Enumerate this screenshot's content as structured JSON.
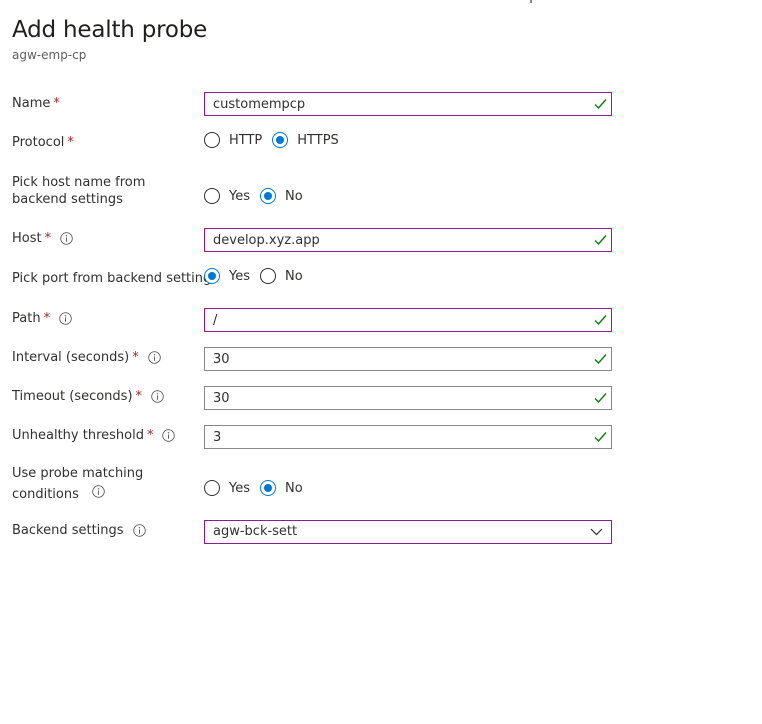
{
  "page": {
    "title": "Add health probe",
    "subtitle": "agw-emp-cp"
  },
  "form": {
    "name": {
      "label": "Name",
      "required": "*",
      "value": "customempcp"
    },
    "protocol": {
      "label": "Protocol",
      "required": "*",
      "options": [
        "HTTP",
        "HTTPS"
      ],
      "selected": "HTTPS"
    },
    "pick_host": {
      "label": "Pick host name from backend settings",
      "options": [
        "Yes",
        "No"
      ],
      "selected": "No"
    },
    "host": {
      "label": "Host",
      "required": "*",
      "value": "develop.xyz.app"
    },
    "pick_port": {
      "label": "Pick port from backend settings",
      "options": [
        "Yes",
        "No"
      ],
      "selected": "Yes"
    },
    "path": {
      "label": "Path",
      "required": "*",
      "value": "/"
    },
    "interval": {
      "label": "Interval (seconds)",
      "required": "*",
      "value": "30"
    },
    "timeout": {
      "label": "Timeout (seconds)",
      "required": "*",
      "value": "30"
    },
    "unhealthy": {
      "label": "Unhealthy threshold",
      "required": "*",
      "value": "3"
    },
    "matching": {
      "label": "Use probe matching conditions",
      "options": [
        "Yes",
        "No"
      ],
      "selected": "No"
    },
    "backend": {
      "label": "Backend settings",
      "value": "agw-bck-sett"
    }
  },
  "colors": {
    "accent": "#0078d4",
    "required": "#a4262c",
    "valid": "#107c10",
    "focus_border": "#8a1c98"
  },
  "icons": {
    "info": "info-icon",
    "valid": "checkmark-icon",
    "dropdown": "chevron-down-icon"
  }
}
